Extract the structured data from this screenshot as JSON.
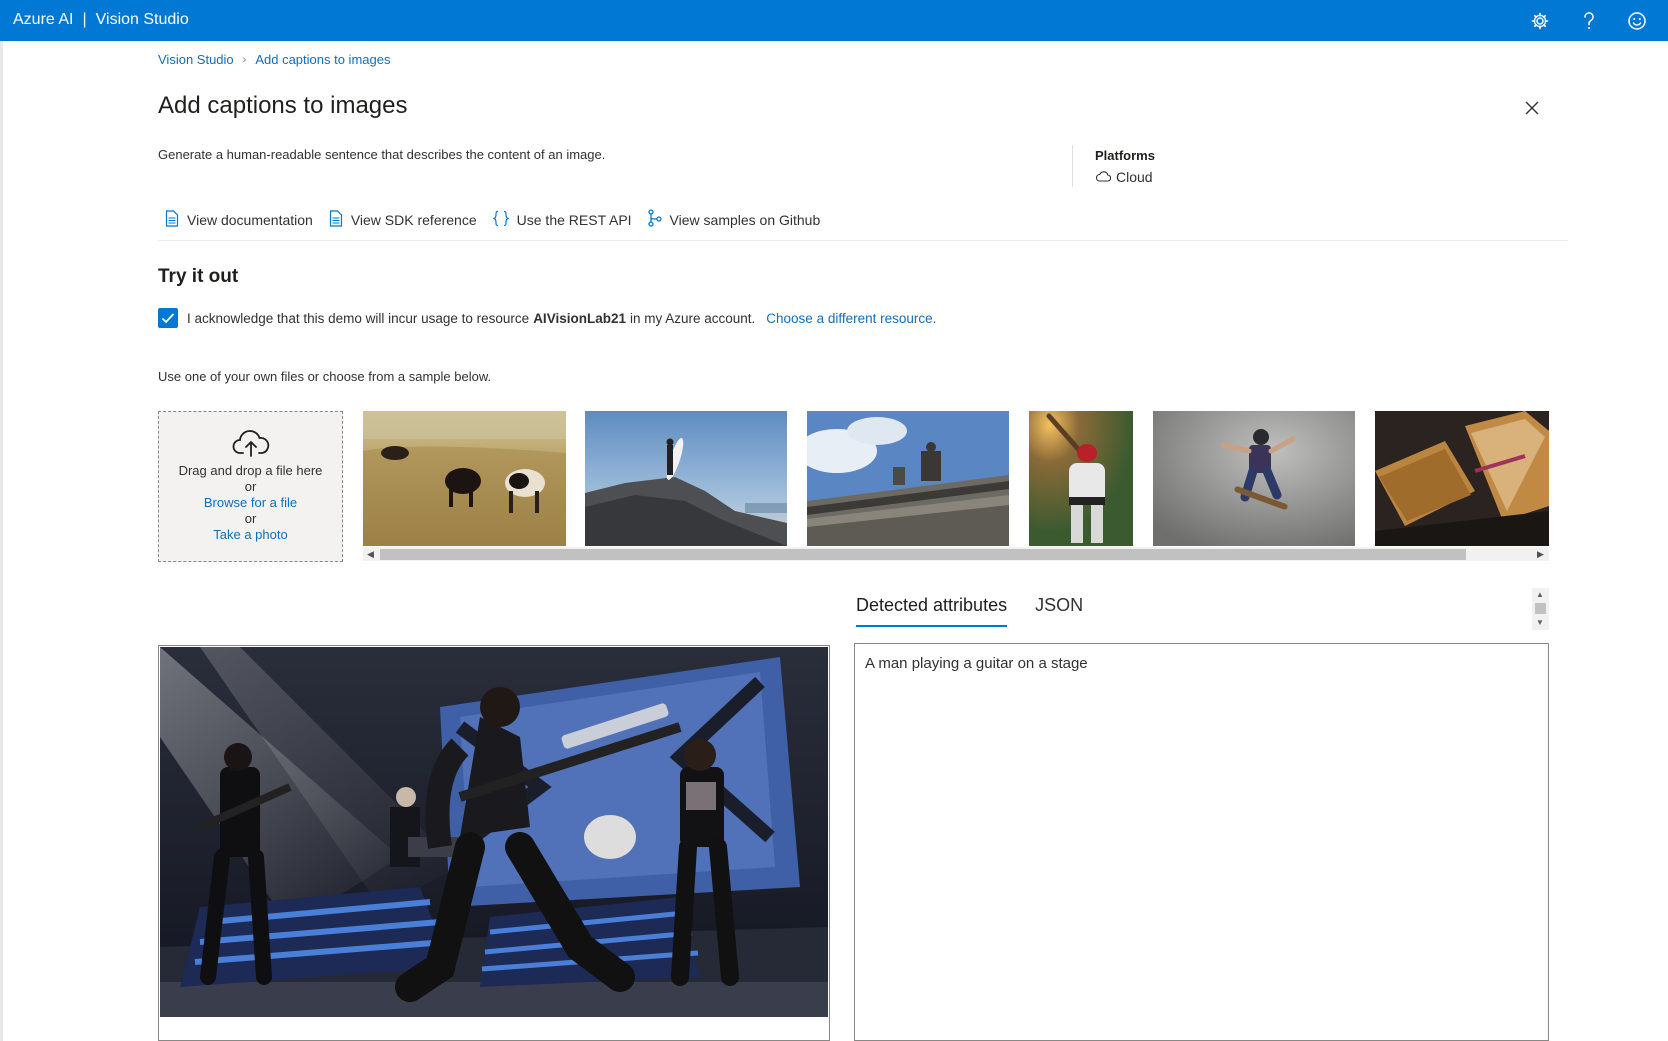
{
  "topbar": {
    "brand_left": "Azure AI",
    "brand_sep": "|",
    "brand_right": "Vision Studio",
    "icons": [
      "gear-icon",
      "help-icon",
      "feedback-smiley-icon"
    ],
    "color": "#0078d4"
  },
  "breadcrumb": {
    "items": [
      "Vision Studio",
      "Add captions to images"
    ],
    "separator": "›"
  },
  "page": {
    "title": "Add captions to images",
    "description": "Generate a human-readable sentence that describes the content of an image."
  },
  "platforms": {
    "label": "Platforms",
    "value": "Cloud"
  },
  "links": [
    {
      "label": "View documentation",
      "icon": "document-icon"
    },
    {
      "label": "View SDK reference",
      "icon": "document-icon"
    },
    {
      "label": "Use the REST API",
      "icon": "braces-icon"
    },
    {
      "label": "View samples on Github",
      "icon": "branch-icon"
    }
  ],
  "try_it": {
    "heading": "Try it out",
    "ack_prefix": "I acknowledge that this demo will incur usage to resource",
    "resource": "AIVisionLab21",
    "ack_suffix": "in my Azure account.",
    "choose_link": "Choose a different resource.",
    "checked": true,
    "use_own": "Use one of your own files or choose from a sample below."
  },
  "dropzone": {
    "line1": "Drag and drop a file here",
    "or1": "or",
    "browse": "Browse for a file",
    "or2": "or",
    "photo": "Take a photo"
  },
  "samples": [
    "cows-grazing",
    "surfer-on-rock",
    "building-statue",
    "baseball-batter",
    "skateboarder",
    "grilled-sandwich"
  ],
  "results": {
    "tabs": [
      "Detected attributes",
      "JSON"
    ],
    "active_tab": "Detected attributes",
    "caption": "A man playing a guitar on a stage"
  },
  "accent": "#0078d4",
  "link_color": "#106ebe"
}
